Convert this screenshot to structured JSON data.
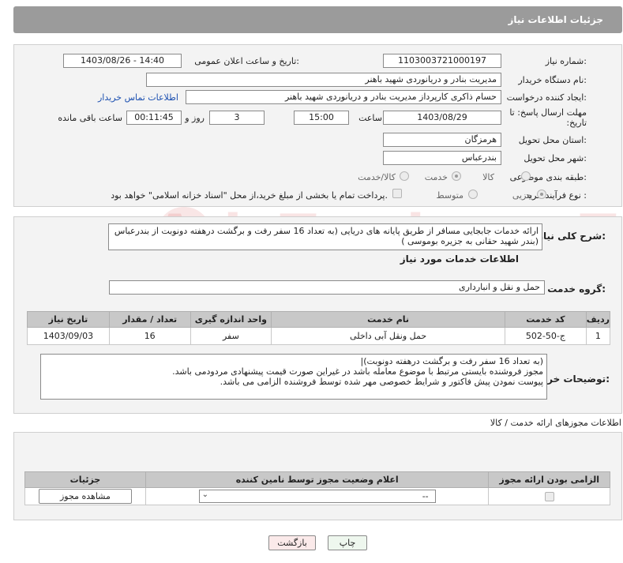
{
  "header": {
    "title": "جزئیات اطلاعات نیاز"
  },
  "form": {
    "need_number_label": "شماره نیاز:",
    "need_number": "1103003721000197",
    "announce_label": "تاریخ و ساعت اعلان عمومی:",
    "announce_value": "1403/08/26 - 14:40",
    "buyer_org_label": "نام دستگاه خریدار:",
    "buyer_org": "مدیریت بنادر و دریانوردی شهید باهنر",
    "creator_label": "ایجاد کننده درخواست:",
    "creator": "حسام  ذاکری کارپرداز مدیریت بنادر و دریانوردی شهید باهنر",
    "contact_link": "اطلاعات تماس خریدار",
    "deadline_label": "مهلت ارسال پاسخ: تا تاریخ:",
    "deadline_date": "1403/08/29",
    "time_label": "ساعت",
    "deadline_time": "15:00",
    "days_value": "3",
    "days_label": "روز و",
    "remaining_time": "00:11:45",
    "remaining_label": "ساعت باقی مانده",
    "province_label": "استان محل تحویل:",
    "province": "هرمزگان",
    "city_label": "شهر محل تحویل:",
    "city": "بندرعباس",
    "category_label": "طبقه بندی موضوعی:",
    "category_options": [
      "کالا",
      "خدمت",
      "کالا/خدمت"
    ],
    "category_selected": "خدمت",
    "process_label": "نوع فرآیند خرید :",
    "process_options": [
      "جزیی",
      "متوسط"
    ],
    "process_selected": "جزیی",
    "payment_note": "پرداخت تمام یا بخشی از مبلغ خرید،از محل \"اسناد خزانه اسلامی\" خواهد بود."
  },
  "summary": {
    "label": "شرح کلی نیاز:",
    "text": "ارائه خدمات جابجایی مسافر از طریق پایانه های دریایی  (به تعداد 16 سفر رفت و برگشت درهفته دونوبت  از بندرعباس (بندر شهید حقانی به جزیره بوموسی )"
  },
  "services": {
    "title": "اطلاعات خدمات مورد نیاز",
    "group_label": "گروه خدمت:",
    "group_value": "حمل و نقل و انبارداری",
    "columns": [
      "ردیف",
      "کد خدمت",
      "نام خدمت",
      "واحد اندازه گیری",
      "تعداد / مقدار",
      "تاریخ نیاز"
    ],
    "rows": [
      {
        "idx": "1",
        "code": "ج-50-502",
        "name": "حمل ونقل آبی داخلی",
        "unit": "سفر",
        "qty": "16",
        "date": "1403/09/03"
      }
    ]
  },
  "buyer_notes": {
    "label": "توضیحات خریدار:",
    "lines": [
      "(به تعداد 16 سفر رفت و برگشت درهفته دونوبت)|",
      "مجوز فروشنده بایستی مرتبط با موضوع معامله باشد در غیراین صورت قیمت پیشنهادی مردودمی باشد.",
      "پیوست نمودن پیش فاکتور و شرایط خصوصی مهر شده توسط فروشنده الزامی می باشد."
    ]
  },
  "permits": {
    "title": "اطلاعات مجوزهای ارائه خدمت / کالا",
    "columns": [
      "الزامی بودن ارائه مجوز",
      "اعلام وضعیت مجوز توسط نامین کننده",
      "جزئیات"
    ],
    "select_value": "--",
    "view_button": "مشاهده مجوز"
  },
  "actions": {
    "print": "چاپ",
    "back": "بازگشت"
  },
  "watermark": "AriaTender.neT"
}
